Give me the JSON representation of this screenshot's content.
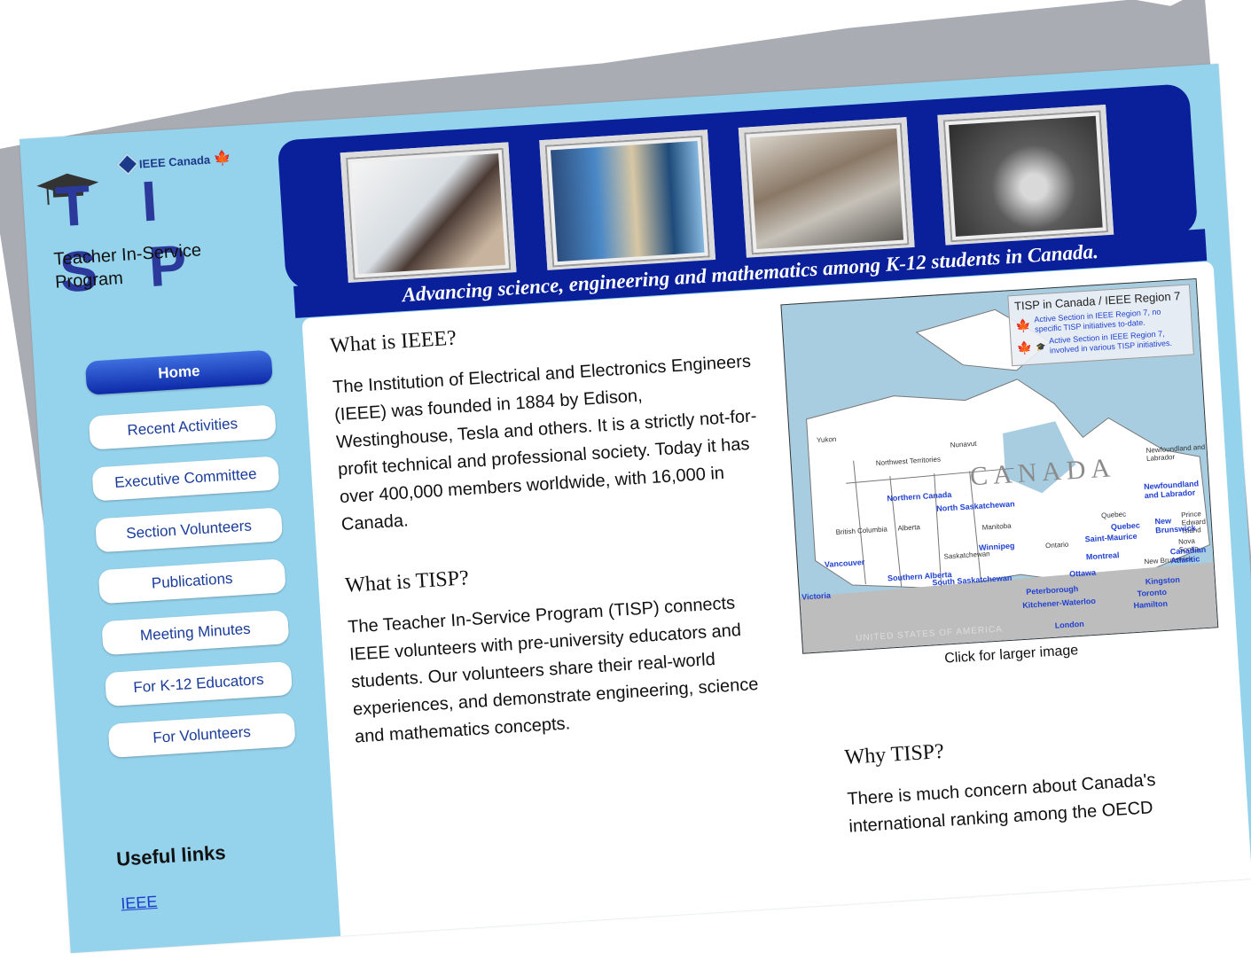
{
  "logo": {
    "ieee_canada": "IEEE Canada",
    "letters": "T I S P"
  },
  "site": {
    "subtitle_line1": "Teacher In-Service",
    "subtitle_line2": "Program",
    "tagline": "Advancing science, engineering and mathematics among K-12 students in Canada."
  },
  "nav": {
    "items": [
      {
        "label": "Home",
        "active": true
      },
      {
        "label": "Recent Activities"
      },
      {
        "label": "Executive Committee"
      },
      {
        "label": "Section Volunteers"
      },
      {
        "label": "Publications"
      },
      {
        "label": "Meeting Minutes"
      },
      {
        "label": "For K-12 Educators"
      },
      {
        "label": "For Volunteers"
      }
    ]
  },
  "useful_links": {
    "heading": "Useful links",
    "items": [
      "IEEE"
    ]
  },
  "sections": {
    "ieee_title": "What is IEEE?",
    "ieee_text": "The Institution of Electrical and Electronics Engineers (IEEE) was founded in 1884 by Edison, Westinghouse, Tesla and others.  It is a strictly not-for-profit technical and professional society. Today it has over 400,000 members worldwide, with 16,000 in Canada.",
    "tisp_title": "What is TISP?",
    "tisp_text": "The Teacher In-Service Program (TISP) connects IEEE volunteers with pre-university educators and students.  Our volunteers share their real-world experiences, and demonstrate engineering, science and mathematics concepts.",
    "why_title": "Why TISP?",
    "why_text": "There is much concern about Canada's international ranking among the OECD"
  },
  "map": {
    "legend_title": "TISP in Canada / IEEE Region 7",
    "legend_1": "Active Section in IEEE Region 7, no specific TISP initiatives to-date.",
    "legend_2": "Active Section in IEEE Region 7, involved in various TISP initiatives.",
    "country_label": "CANADA",
    "usa_label": "UNITED STATES OF AMERICA",
    "caption": "Click for larger image",
    "provinces": [
      "Yukon",
      "Northwest Territories",
      "Nunavut",
      "British Columbia",
      "Alberta",
      "Saskatchewan",
      "Manitoba",
      "Ontario",
      "Quebec",
      "Newfoundland and Labrador",
      "Prince Edward Island",
      "Nova Scotia",
      "New Brunswick"
    ],
    "cities": [
      "Northern Canada",
      "North Saskatchewan",
      "Vancouver",
      "Victoria",
      "Southern Alberta",
      "South Saskatchewan",
      "Winnipeg",
      "Saint-Maurice",
      "Quebec",
      "Montreal",
      "Ottawa",
      "Peterborough",
      "Kitchener-Waterloo",
      "London",
      "Toronto",
      "Hamilton",
      "Kingston",
      "Newfoundland and Labrador",
      "New Brunswick",
      "Canadian Atlantic"
    ]
  }
}
